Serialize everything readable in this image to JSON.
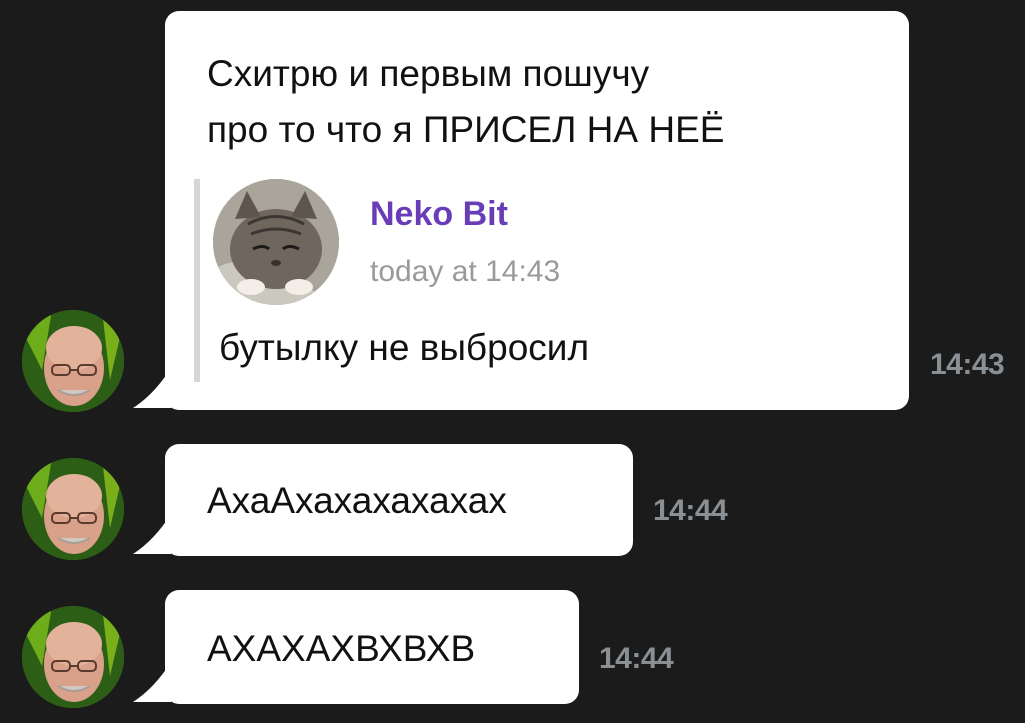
{
  "messages": [
    {
      "lines": [
        "Схитрю и первым пошучу",
        "про то что я ПРИСЕЛ НА НЕЁ"
      ],
      "time": "14:43",
      "reply": {
        "author": "Neko Bit",
        "date": "today at 14:43",
        "text": "бутылку не выбросил"
      }
    },
    {
      "text": "АхаАхахахахахах",
      "time": "14:44"
    },
    {
      "text": "АХАХАХВХВХВ",
      "time": "14:44"
    }
  ],
  "colors": {
    "background": "#1b1b1b",
    "bubble": "#ffffff",
    "reply_author": "#6a3db8",
    "timestamp": "#8a8f94"
  },
  "icons": {
    "sender_avatar": "bald-man-glasses-avatar",
    "reply_avatar": "cat-photo-avatar"
  }
}
